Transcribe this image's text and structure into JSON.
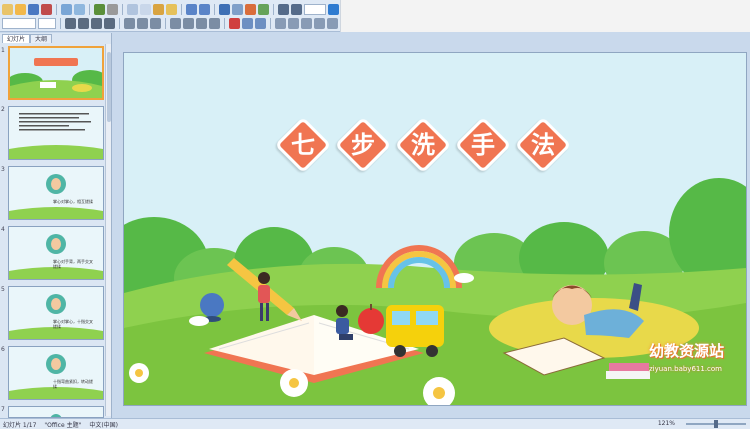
{
  "left_panel": {
    "tabs": [
      {
        "label": "幻灯片"
      },
      {
        "label": "大纲"
      }
    ],
    "thumbnails": [
      {
        "number": "1",
        "selected": true
      },
      {
        "number": "2",
        "selected": false
      },
      {
        "number": "3",
        "selected": false,
        "caption": "掌心对掌心，相互搓揉"
      },
      {
        "number": "4",
        "selected": false,
        "caption": "掌心对手背，两手交叉搓揉"
      },
      {
        "number": "5",
        "selected": false,
        "caption": "掌心对掌心，十指交叉搓揉"
      },
      {
        "number": "6",
        "selected": false,
        "caption": "十指弯曲紧扣，转动搓揉"
      },
      {
        "number": "7",
        "selected": false
      }
    ]
  },
  "slide": {
    "title_chars": [
      "七",
      "步",
      "洗",
      "手",
      "法"
    ],
    "watermark_logo": "幼教资源站",
    "watermark_url": "ziyuan.baby611.com"
  },
  "statusbar": {
    "slide_info": "幻灯片 1/17",
    "theme": "\"Office 主题\"",
    "language": "中文(中国)",
    "zoom": "121%"
  },
  "colors": {
    "title_tile": "#f07552",
    "sky": "#d8f0f7",
    "grass": "#8fd14f",
    "tree": "#56b947"
  }
}
